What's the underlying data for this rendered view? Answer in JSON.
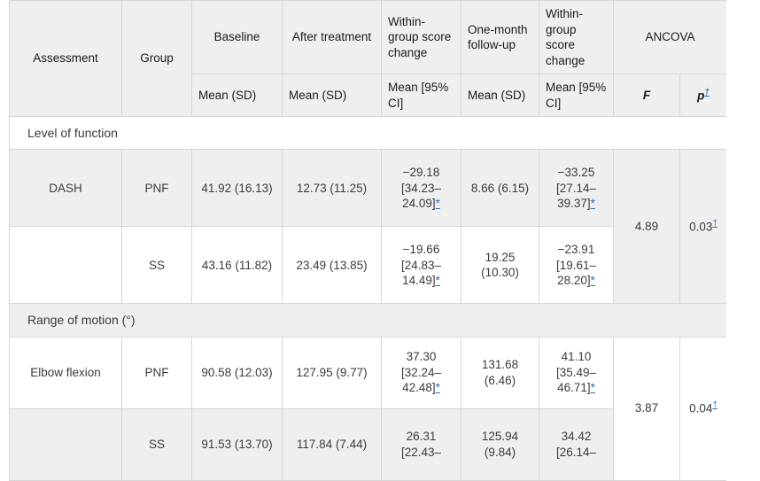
{
  "table": {
    "header": {
      "row1": [
        {
          "label": "Assessment",
          "name": "assessment"
        },
        {
          "label": "Group",
          "name": "group"
        },
        {
          "label": "Baseline",
          "name": "baseline"
        },
        {
          "label": "After treatment",
          "name": "after-treatment"
        },
        {
          "label": "Within-group score change",
          "name": "within-group-score-change-1"
        },
        {
          "label": "One-month follow-up",
          "name": "one-month-follow-up"
        },
        {
          "label": "Within-group score change",
          "name": "within-group-score-change-2"
        },
        {
          "label": "ANCOVA",
          "name": "ancova"
        }
      ],
      "row2": [
        {
          "label": "Mean (SD)",
          "name": "baseline-measure"
        },
        {
          "label": "Mean (SD)",
          "name": "after-treatment-measure"
        },
        {
          "label": "Mean [95% CI]",
          "name": "change-1-measure"
        },
        {
          "label": "Mean (SD)",
          "name": "followup-measure"
        },
        {
          "label": "Mean [95% CI]",
          "name": "change-2-measure"
        },
        {
          "label": "F",
          "name": "f-statistic"
        },
        {
          "label": "p",
          "name": "p-value",
          "superscript": "†"
        }
      ]
    },
    "sections": [
      {
        "title": "Level of function",
        "shaded": false,
        "rows": [
          {
            "shaded": true,
            "assessment": "DASH",
            "group": "PNF",
            "baseline": "41.92 (16.13)",
            "after_treatment": "12.73 (11.25)",
            "change_1": "−29.18 [34.23–24.09]",
            "change_1_marker": "*",
            "followup": "8.66 (6.15)",
            "change_2": "−33.25 [27.14–39.37]",
            "change_2_marker": "*",
            "f": "4.89",
            "p": "0.03",
            "p_superscript": "†"
          },
          {
            "shaded": false,
            "assessment": "",
            "group": "SS",
            "baseline": "43.16 (11.82)",
            "after_treatment": "23.49 (13.85)",
            "change_1": "−19.66 [24.83–14.49]",
            "change_1_marker": "*",
            "followup": "19.25 (10.30)",
            "change_2": "−23.91 [19.61–28.20]",
            "change_2_marker": "*",
            "f": "",
            "p": "",
            "p_superscript": ""
          }
        ]
      },
      {
        "title": "Range of motion (°)",
        "shaded": true,
        "rows": [
          {
            "shaded": false,
            "assessment": "Elbow flexion",
            "group": "PNF",
            "baseline": "90.58 (12.03)",
            "after_treatment": "127.95 (9.77)",
            "change_1": "37.30 [32.24–42.48]",
            "change_1_marker": "*",
            "followup": "131.68 (6.46)",
            "change_2": "41.10 [35.49–46.71]",
            "change_2_marker": "*",
            "f": "3.87",
            "p": "0.04",
            "p_superscript": "†"
          },
          {
            "shaded": true,
            "assessment": "",
            "group": "SS",
            "baseline": "91.53 (13.70)",
            "after_treatment": "117.84 (7.44)",
            "change_1": "26.31 [22.43–",
            "change_1_marker": "",
            "followup": "125.94 (9.84)",
            "change_2": "34.42 [26.14–",
            "change_2_marker": "",
            "f": "",
            "p": "",
            "p_superscript": ""
          }
        ]
      }
    ]
  },
  "colors": {
    "header_background": "#efefef",
    "row_shade": "#efefef",
    "row_light": "#ffffff",
    "border": "#d6d6d6",
    "text": "#3b3b3b",
    "link": "#2b6cb8"
  }
}
